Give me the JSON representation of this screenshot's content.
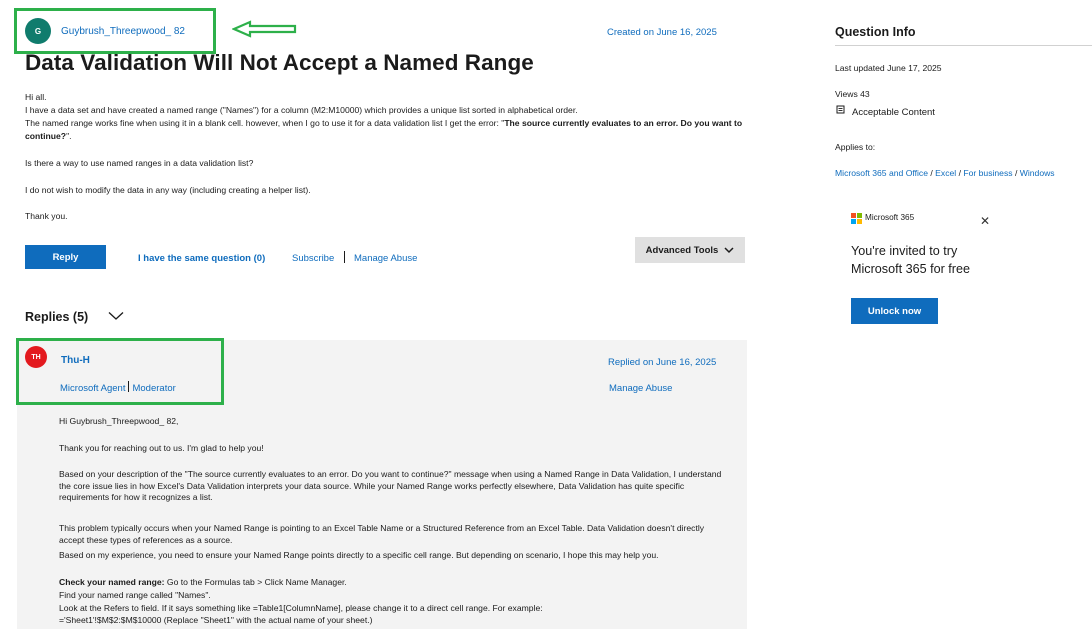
{
  "question": {
    "author_initial": "G",
    "author_name": "Guybrush_Threepwood_ 82",
    "created": "Created on June 16, 2025",
    "title": "Data Validation Will Not Accept a Named Range",
    "body": {
      "p1": "Hi all.",
      "p2": "I have a data set and have created a named range (\"Names\") for a column (M2:M10000) which provides a unique list sorted in alphabetical order.",
      "p3_plain": "The named range works fine when using it in a blank cell. however, when I go to use it for a data validation list I get the error: \"",
      "p3_bold": "The source currently evaluates to an error. Do you want to continue?",
      "p3_end": "\".",
      "p4": "Is there a way to use named ranges in a data validation list?",
      "p5": "I do not wish to modify the data in any way (including creating a helper list).",
      "p6": "Thank you."
    },
    "actions": {
      "reply": "Reply",
      "same_question": "I have the same question (0)",
      "subscribe": "Subscribe",
      "manage_abuse": "Manage Abuse",
      "advanced_tools": "Advanced Tools"
    }
  },
  "replies": {
    "header": "Replies (5)",
    "items": [
      {
        "initials": "TH",
        "name": "Thu-H",
        "role": "Microsoft Agent",
        "role2": "Moderator",
        "replied": "Replied on June 16, 2025",
        "manage_abuse": "Manage Abuse",
        "greeting": "Hi Guybrush_Threepwood_ 82,",
        "thanks": "Thank you for reaching out to us. I'm glad to help you!",
        "para1": "Based on your description of the \"The source currently evaluates to an error. Do you want to continue?\" message when using a Named Range in Data Validation, I understand the core issue lies in how Excel's Data Validation interprets your data source. While your Named Range works perfectly elsewhere, Data Validation has quite specific requirements for how it recognizes a list.",
        "para2a": "This problem typically occurs when your Named Range is pointing to an Excel Table Name or a Structured Reference from an Excel Table. Data Validation doesn't directly accept these types of references as a source.",
        "para2b": "Based on my experience, you need to ensure your Named Range points directly to a specific cell range. But depending on scenario, I hope this may help you.",
        "check_bold": "Check your named range:",
        "check_rest": " Go to the Formulas tab > Click Name Manager.",
        "find": "Find your named range called \"Names\".",
        "look": "Look at the Refers to field. If it says something like =Table1[ColumnName], please change it to a direct cell range. For example: ='Sheet1'!$M$2:$M$10000 (Replace \"Sheet1\" with the actual name of your sheet.)"
      }
    ]
  },
  "sidebar": {
    "title": "Question Info",
    "last_updated": "Last updated June 17, 2025",
    "views": "Views 43",
    "acceptable": "Acceptable Content",
    "applies_label": "Applies to:",
    "applies": [
      "Microsoft 365 and Office",
      "Excel",
      "For business",
      "Windows"
    ],
    "promo": {
      "brand": "Microsoft 365",
      "line1": "You're invited to try",
      "line2": "Microsoft 365 for free",
      "button": "Unlock now"
    }
  },
  "colors": {
    "link": "#0f6cbd",
    "highlight_box": "#2db04a",
    "reply_bg": "#f3f3f3",
    "avatar_g": "#107c6d",
    "avatar_th": "#e3191e"
  }
}
